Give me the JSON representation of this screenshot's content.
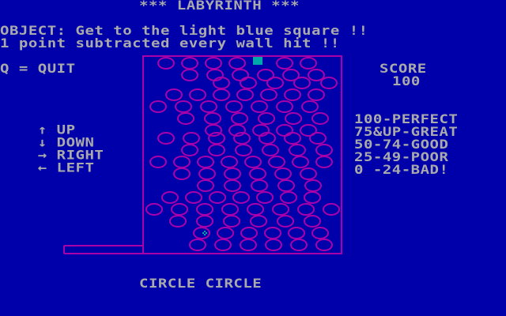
{
  "header": {
    "title": "*** LABYRINTH ***",
    "objective_line1": "OBJECT: Get to the light blue square !!",
    "objective_line2": "1 point subtracted every wall hit !!"
  },
  "left_panel": {
    "quit_hint": "Q = QUIT",
    "controls": [
      {
        "icon": "arrow-up-icon",
        "glyph": "↑",
        "label": "UP"
      },
      {
        "icon": "arrow-down-icon",
        "glyph": "↓",
        "label": "DOWN"
      },
      {
        "icon": "arrow-right-icon",
        "glyph": "→",
        "label": "RIGHT"
      },
      {
        "icon": "arrow-left-icon",
        "glyph": "←",
        "label": "LEFT"
      }
    ]
  },
  "right_panel": {
    "score_label": "SCORE",
    "score_value": "100",
    "ratings": [
      "100-PERFECT",
      "75&UP-GREAT",
      "50-74-GOOD",
      "25-49-POOR",
      "0 -24-BAD!"
    ]
  },
  "level_name": "CIRCLE CIRCLE",
  "colors": {
    "background": "#0000aa",
    "text": "#aaaaaa",
    "walls": "#aa00aa",
    "goal": "#00aaaa",
    "player": "#00aaaa"
  }
}
